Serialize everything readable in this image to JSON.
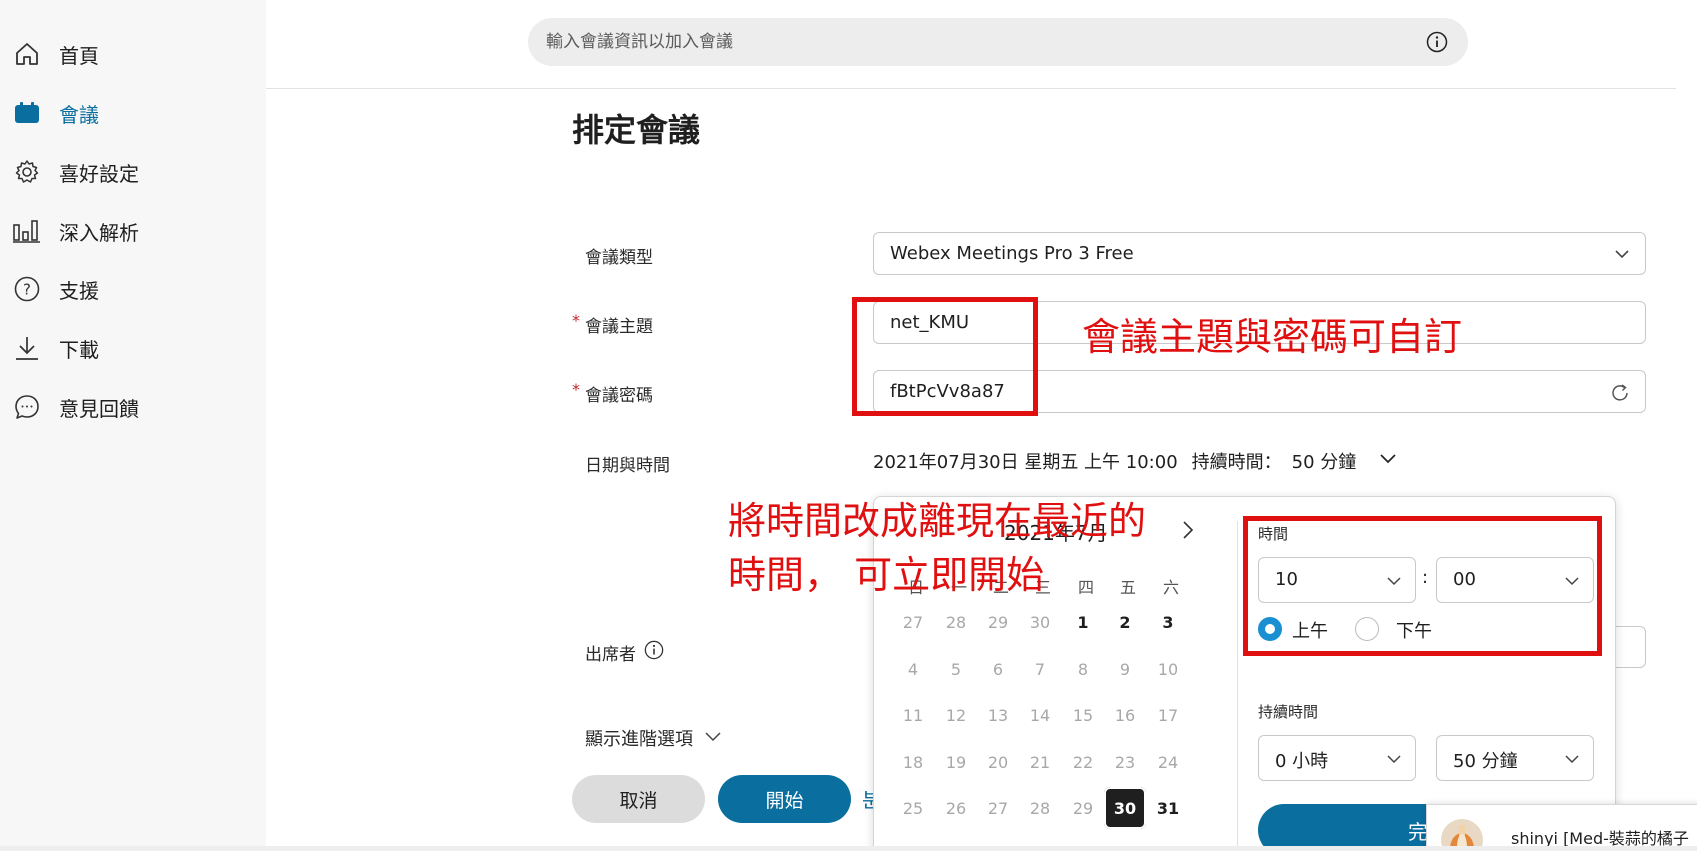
{
  "sidebar": {
    "items": [
      {
        "label": "首頁",
        "icon": "home-icon",
        "active": false
      },
      {
        "label": "會議",
        "icon": "calendar-icon",
        "active": true
      },
      {
        "label": "喜好設定",
        "icon": "gear-icon",
        "active": false
      },
      {
        "label": "深入解析",
        "icon": "bar-chart-icon",
        "active": false
      },
      {
        "label": "支援",
        "icon": "help-icon",
        "active": false
      },
      {
        "label": "下載",
        "icon": "download-icon",
        "active": false
      },
      {
        "label": "意見回饋",
        "icon": "chat-icon",
        "active": false
      }
    ]
  },
  "search": {
    "placeholder": "輸入會議資訊以加入會議",
    "icon": "info-icon"
  },
  "page": {
    "title": "排定會議"
  },
  "form": {
    "meeting_type": {
      "label": "會議類型",
      "value": "Webex Meetings Pro 3 Free"
    },
    "topic": {
      "label": "會議主題",
      "value": "net_KMU",
      "required_mark": "*"
    },
    "password": {
      "label": "會議密碼",
      "value": "fBtPcVv8a87",
      "required_mark": "*"
    },
    "datetime": {
      "label": "日期與時間",
      "value": "2021年07月30日 星期五 上午 10:00",
      "duration_label": "持續時間：",
      "duration_value": "50 分鐘"
    },
    "attendees": {
      "label": "出席者"
    },
    "advanced": {
      "label": "顯示進階選項"
    }
  },
  "picker": {
    "month": "2021年7月",
    "weekdays": [
      "日",
      "一",
      "二",
      "三",
      "四",
      "五",
      "六"
    ],
    "weeks": [
      [
        "27",
        "28",
        "29",
        "30",
        "1",
        "2",
        "3"
      ],
      [
        "4",
        "5",
        "6",
        "7",
        "8",
        "9",
        "10"
      ],
      [
        "11",
        "12",
        "13",
        "14",
        "15",
        "16",
        "17"
      ],
      [
        "18",
        "19",
        "20",
        "21",
        "22",
        "23",
        "24"
      ],
      [
        "25",
        "26",
        "27",
        "28",
        "29",
        "30",
        "31"
      ]
    ],
    "selected_day": "30",
    "time_label": "時間",
    "hour": "10",
    "colon": ":",
    "minute": "00",
    "am_label": "上午",
    "pm_label": "下午",
    "am_selected": true,
    "duration_label": "持續時間",
    "duration_hours": "0 小時",
    "duration_minutes": "50 分鐘",
    "done_label": "完"
  },
  "buttons": {
    "cancel": "取消",
    "start": "開始",
    "link_partial": "분"
  },
  "annotations": {
    "topic_note": "會議主題與密碼可自訂",
    "time_note_line1": "將時間改成離現在最近的",
    "time_note_line2": "時間， 可立即開始"
  },
  "toast": {
    "name": "shinyi [Med-裝蒜的橘子"
  },
  "colors": {
    "accent": "#0a6e9e",
    "annotation": "#e01010",
    "sidebar_bg": "#f7f7f7"
  }
}
